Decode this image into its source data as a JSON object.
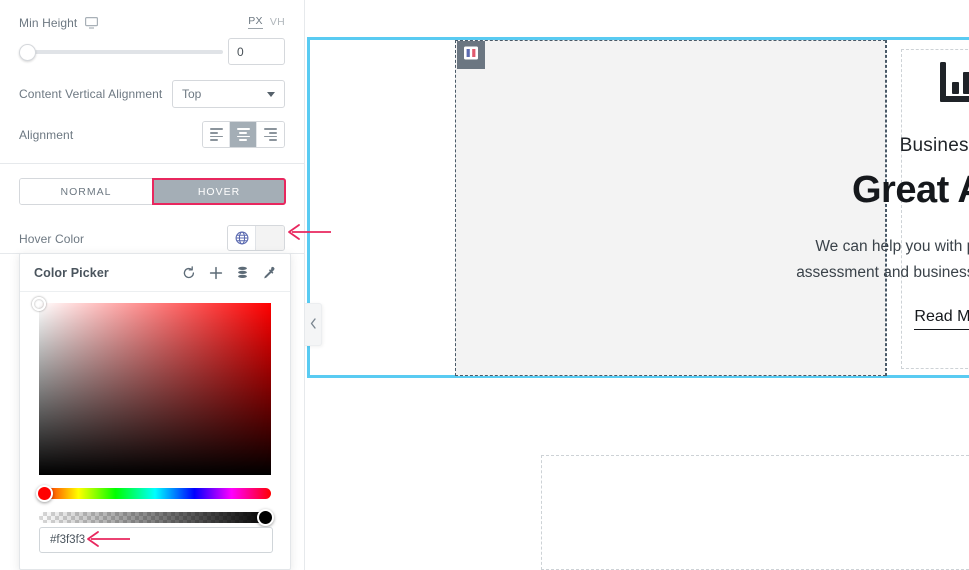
{
  "panel": {
    "min_height": {
      "label": "Min Height",
      "device_icon": "monitor-icon",
      "units": [
        {
          "label": "PX",
          "active": true
        },
        {
          "label": "VH",
          "active": false
        }
      ],
      "value": "0",
      "slider_position_pct": 0
    },
    "content_vertical_alignment": {
      "label": "Content Vertical Alignment",
      "value": "Top"
    },
    "alignment": {
      "label": "Alignment",
      "options": [
        {
          "name": "align-left",
          "active": false
        },
        {
          "name": "align-center",
          "active": true
        },
        {
          "name": "align-right",
          "active": false
        }
      ]
    },
    "state_tabs": [
      {
        "label": "NORMAL",
        "active": false
      },
      {
        "label": "HOVER",
        "active": true,
        "highlight_color": "#e8275e"
      }
    ],
    "hover_color": {
      "label": "Hover Color",
      "globe_icon": "globe-icon",
      "swatch_color": "#f3f3f3"
    }
  },
  "color_picker": {
    "title": "Color Picker",
    "tools": [
      {
        "name": "reset-icon"
      },
      {
        "name": "add-icon"
      },
      {
        "name": "swatches-icon"
      },
      {
        "name": "eyedropper-icon"
      }
    ],
    "hue": "#ff0000",
    "hue_handle_pct": 0,
    "alpha_handle_pct": 100,
    "hex_value": "#f3f3f3",
    "hex_placeholder": "#f3f3f3"
  },
  "canvas": {
    "collapse_handle_icon": "chevron-left-icon",
    "column_handle_icon": "columns-icon",
    "widget_handle_icon": "pencil-icon",
    "selection_color": "#59cbf2",
    "card": {
      "icon": "bar-chart-icon",
      "eyebrow": "Business Ideas",
      "title": "Great Advice",
      "body": "We can help you with problem analysis, risk assessment and business advice on future steps.",
      "cta_label": "Read More",
      "cta_icon": "chevron-right-icon"
    }
  },
  "annotations": {
    "color": "#e8275e",
    "items": [
      {
        "name": "arrow-to-color-swatch"
      },
      {
        "name": "arrow-to-hex-input"
      }
    ]
  }
}
